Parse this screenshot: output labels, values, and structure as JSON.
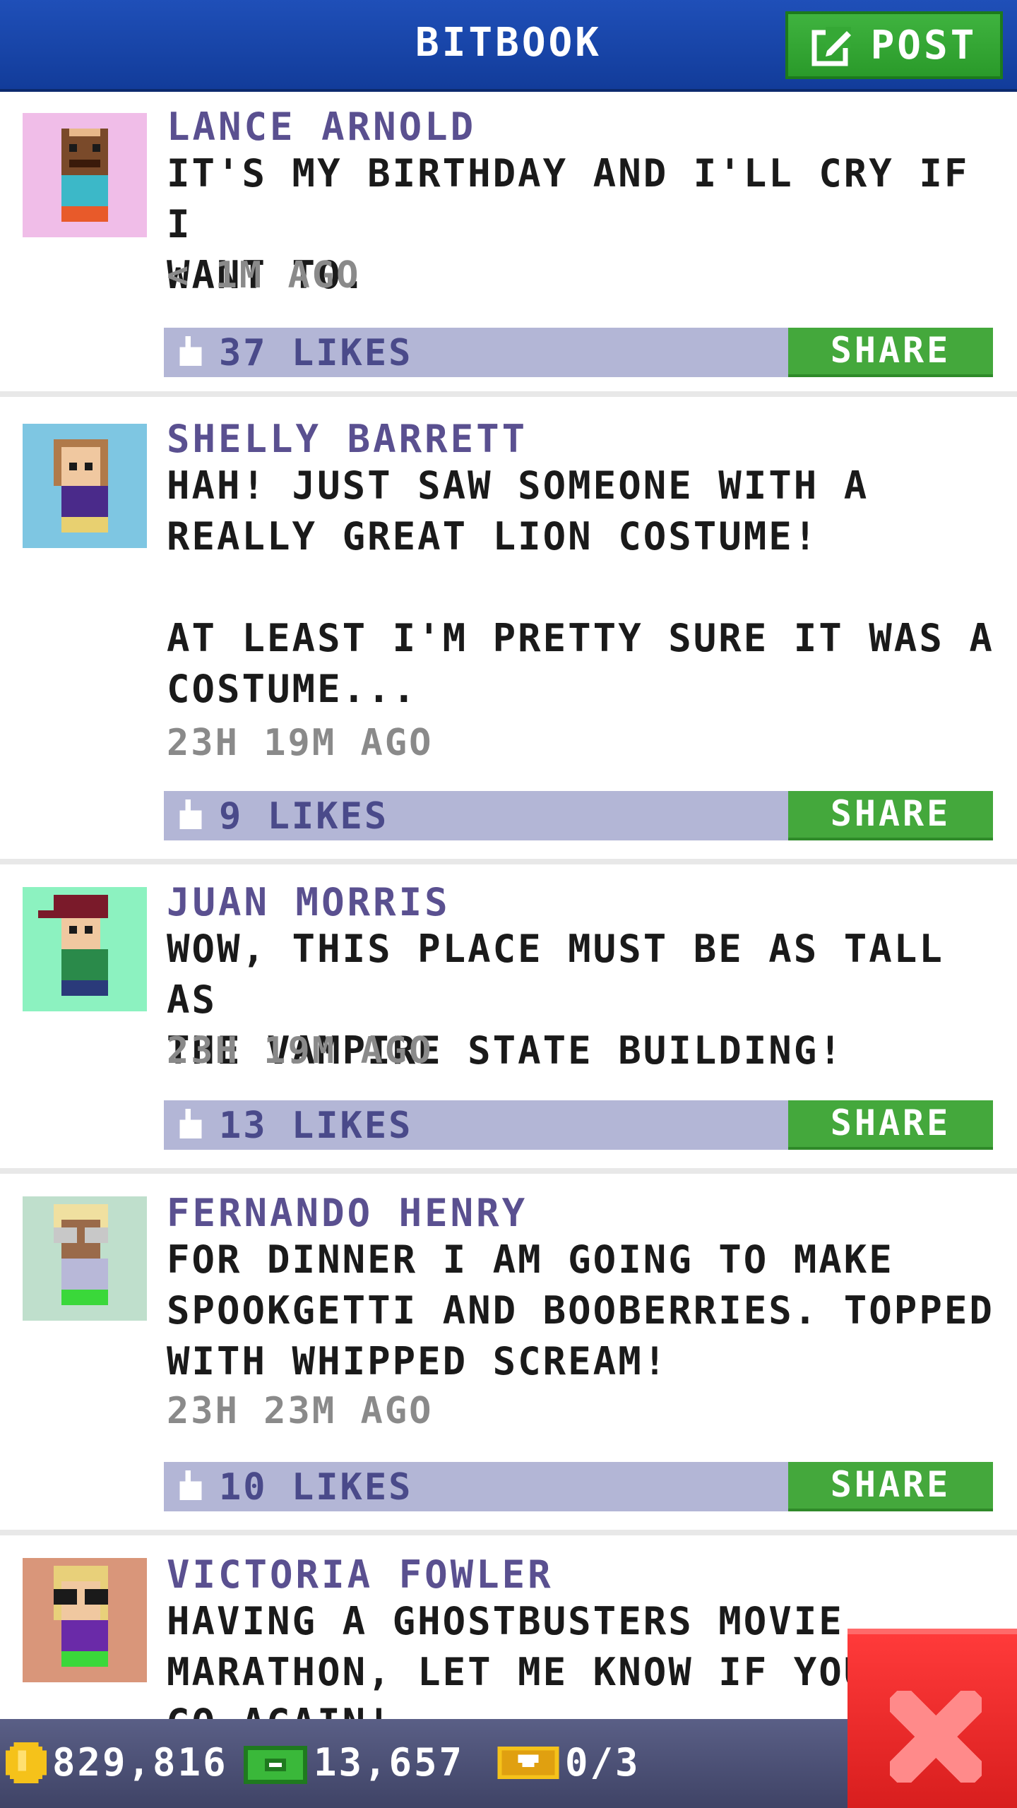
{
  "header": {
    "title": "BITBOOK",
    "post_label": "POST"
  },
  "posts": [
    {
      "author": "LANCE ARNOLD",
      "text": "IT'S MY BIRTHDAY AND I'LL CRY IF I\nWANT TO.",
      "time": "< 1M AGO",
      "likes": "37 LIKES",
      "share": "SHARE",
      "avatar_bg": "#f0bde8"
    },
    {
      "author": "SHELLY BARRETT",
      "text": "HAH! JUST SAW SOMEONE WITH A\nREALLY GREAT LION COSTUME!\n\nAT LEAST I'M PRETTY SURE IT WAS A\nCOSTUME...",
      "time": "23H 19M AGO",
      "likes": "9 LIKES",
      "share": "SHARE",
      "avatar_bg": "#7ec6e2"
    },
    {
      "author": "JUAN MORRIS",
      "text": "WOW, THIS PLACE MUST BE AS TALL AS\nTHE VAMPIRE STATE BUILDING!",
      "time": "23H 19M AGO",
      "likes": "13 LIKES",
      "share": "SHARE",
      "avatar_bg": "#8cf2c0"
    },
    {
      "author": "FERNANDO HENRY",
      "text": "FOR DINNER I AM GOING TO MAKE\nSPOOKGETTI AND BOOBERRIES. TOPPED\nWITH WHIPPED SCREAM!",
      "time": "23H 23M AGO",
      "likes": "10 LIKES",
      "share": "SHARE",
      "avatar_bg": "#bfdfcc"
    },
    {
      "author": "VICTORIA FOWLER",
      "text": "HAVING A GHOSTBUSTERS MOVIE\nMARATHON, LET ME KNOW IF YOU\nGO AGAIN!",
      "time": "",
      "likes": "",
      "share": "",
      "avatar_bg": "#d9967a"
    }
  ],
  "footer": {
    "coins": "829,816",
    "bux": "13,657",
    "tickets": "0/3"
  },
  "colors": {
    "header": "#1a47a8",
    "share": "#44a83c",
    "likes_bar": "#b3b6d6",
    "close": "#e82828"
  }
}
